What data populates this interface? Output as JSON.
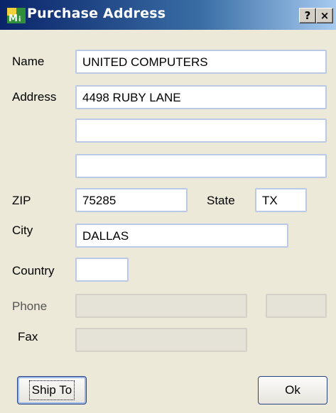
{
  "window": {
    "title": "Purchase Address"
  },
  "titlebar_buttons": {
    "help": "?",
    "close": "×"
  },
  "labels": {
    "name": "Name",
    "address": "Address",
    "zip": "ZIP",
    "state": "State",
    "city": "City",
    "country": "Country",
    "phone": "Phone",
    "fax": "Fax"
  },
  "fields": {
    "name": "UNITED COMPUTERS",
    "address1": "4498 RUBY LANE",
    "address2": "",
    "address3": "",
    "zip": "75285",
    "state": "TX",
    "city": "DALLAS",
    "country": "",
    "phone": "",
    "phone_ext": "",
    "fax": ""
  },
  "buttons": {
    "ship_to": "Ship To",
    "ok": "Ok"
  }
}
